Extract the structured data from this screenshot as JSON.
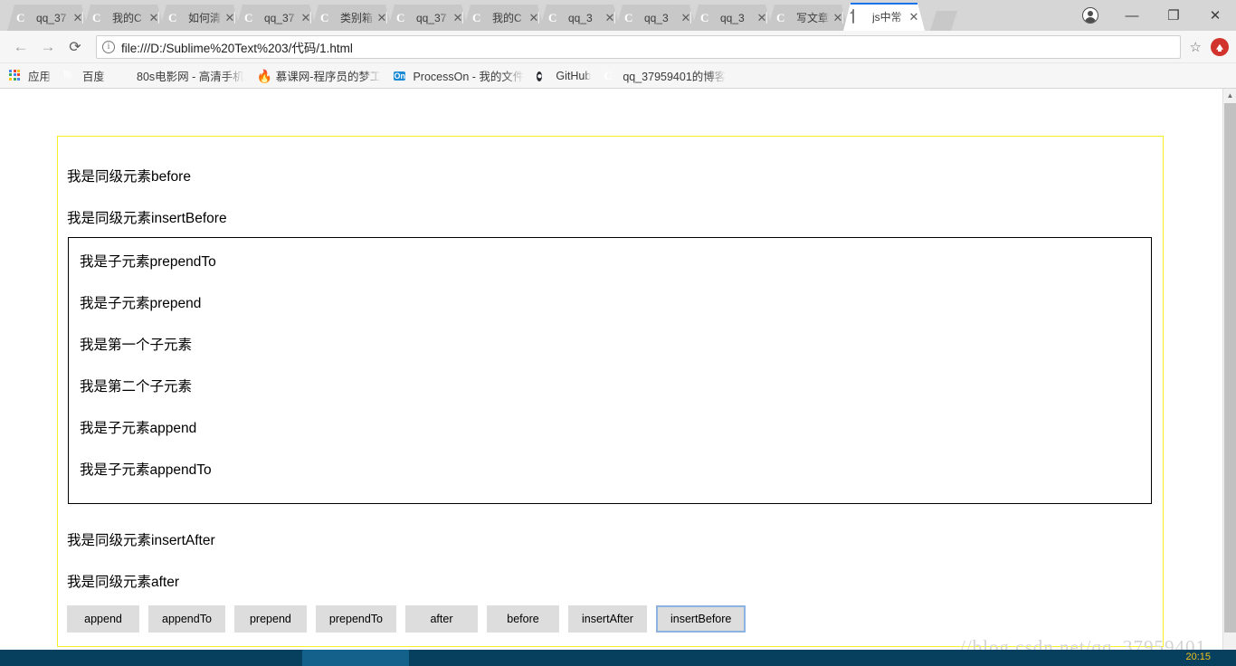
{
  "window": {
    "controls": {
      "minimize": "—",
      "maximize": "❐",
      "close": "✕"
    },
    "profile_icon": "account-avatar-icon"
  },
  "tabs": [
    {
      "title": "qq_37",
      "icon": "csdn-favicon",
      "active": false
    },
    {
      "title": "我的C",
      "icon": "csdn-favicon",
      "active": false
    },
    {
      "title": "如何清",
      "icon": "csdn-favicon",
      "active": false
    },
    {
      "title": "qq_37",
      "icon": "csdn-favicon",
      "active": false
    },
    {
      "title": "类别箱",
      "icon": "csdn-favicon",
      "active": false
    },
    {
      "title": "qq_37",
      "icon": "csdn-favicon",
      "active": false
    },
    {
      "title": "我的C",
      "icon": "csdn-favicon",
      "active": false
    },
    {
      "title": "qq_3",
      "icon": "csdn-favicon",
      "active": false
    },
    {
      "title": "qq_3",
      "icon": "csdn-favicon",
      "active": false
    },
    {
      "title": "qq_3",
      "icon": "csdn-favicon",
      "active": false
    },
    {
      "title": "写文章",
      "icon": "csdn-favicon",
      "active": false
    },
    {
      "title": "js中常",
      "icon": "document-favicon",
      "active": true
    }
  ],
  "toolbar": {
    "back": "←",
    "forward": "→",
    "reload": "⟳",
    "site_info_icon": "info-circle-icon",
    "url": "file:///D:/Sublime%20Text%203/代码/1.html",
    "bookmark_star": "☆",
    "extension_icon": "red-upload-extension-icon"
  },
  "bookmarks": [
    {
      "label": "应用",
      "icon": "apps-grid-icon"
    },
    {
      "label": "百度",
      "icon": "baidu-icon"
    },
    {
      "label": "80s电影网 - 高清手机",
      "icon": "film-icon"
    },
    {
      "label": "慕课网-程序员的梦工",
      "icon": "flame-icon"
    },
    {
      "label": "ProcessOn - 我的文件",
      "icon": "processon-icon"
    },
    {
      "label": "GitHub",
      "icon": "github-icon"
    },
    {
      "label": "qq_37959401的博客",
      "icon": "csdn-favicon"
    }
  ],
  "page": {
    "outer_border_color": "#f5f02a",
    "inner_border_color": "#000000",
    "siblings_before": [
      "我是同级元素before",
      "我是同级元素insertBefore"
    ],
    "children": [
      "我是子元素prependTo",
      "我是子元素prepend",
      "我是第一个子元素",
      "我是第二个子元素",
      "我是子元素append",
      "我是子元素appendTo"
    ],
    "siblings_after": [
      "我是同级元素insertAfter",
      "我是同级元素after"
    ],
    "buttons": [
      {
        "label": "append",
        "focused": false
      },
      {
        "label": "appendTo",
        "focused": false
      },
      {
        "label": "prepend",
        "focused": false
      },
      {
        "label": "prependTo",
        "focused": false
      },
      {
        "label": "after",
        "focused": false
      },
      {
        "label": "before",
        "focused": false
      },
      {
        "label": "insertAfter",
        "focused": false
      },
      {
        "label": "insertBefore",
        "focused": true
      }
    ],
    "watermark": "//blog.csdn.net/qq_37959401"
  },
  "scrollbar": {
    "up_arrow": "▲",
    "down_arrow": "▼"
  },
  "taskbar": {
    "background": "#06405e",
    "clock": "20:15"
  }
}
